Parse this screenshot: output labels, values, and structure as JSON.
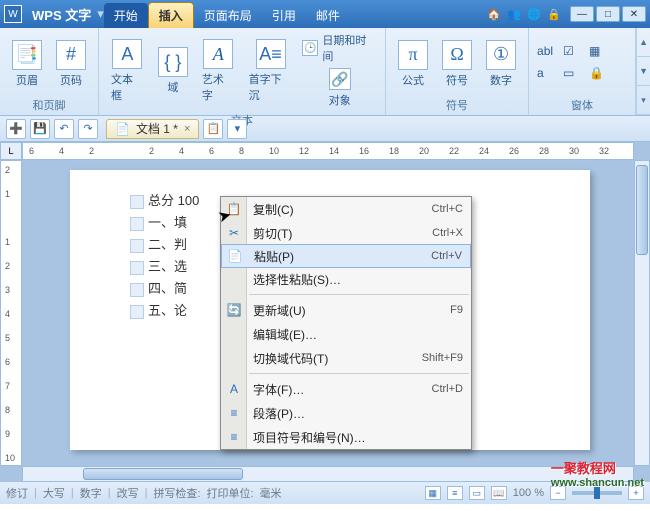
{
  "app": {
    "name": "WPS 文字",
    "icon": "W"
  },
  "tabs": [
    "开始",
    "插入",
    "页面布局",
    "引用",
    "邮件"
  ],
  "active_tab_index": 1,
  "title_icons": [
    "🏠",
    "👥",
    "🌐",
    "🔒"
  ],
  "win": {
    "min": "—",
    "max": "□",
    "close": "✕"
  },
  "ribbon": {
    "groups": [
      {
        "label": "和页脚",
        "big": [
          {
            "icon": "📑",
            "label": "页眉"
          },
          {
            "icon": "#",
            "label": "页码"
          }
        ]
      },
      {
        "label": "文本",
        "big": [
          {
            "icon": "A",
            "label": "文本框"
          },
          {
            "icon": "{ }",
            "label": "域"
          },
          {
            "icon": "A",
            "label": "艺术字",
            "accent": "#2d6fb8"
          },
          {
            "icon": "A≡",
            "label": "首字下沉"
          },
          {
            "icon": "🔗",
            "label": "对象"
          }
        ],
        "stack": [
          {
            "icon": "🕒",
            "label": "日期和时间"
          }
        ]
      },
      {
        "label": "符号",
        "big": [
          {
            "icon": "π",
            "label": "公式"
          },
          {
            "icon": "Ω",
            "label": "符号"
          },
          {
            "icon": "①",
            "label": "数字"
          }
        ]
      },
      {
        "label": "窗体",
        "stack": [
          {
            "icon": "abl",
            "label": ""
          },
          {
            "icon": "☑",
            "label": ""
          },
          {
            "icon": "▦",
            "label": ""
          },
          {
            "icon": "a",
            "label": ""
          },
          {
            "icon": "▭",
            "label": ""
          },
          {
            "icon": "🔒",
            "label": ""
          }
        ]
      }
    ]
  },
  "qat": [
    "➕",
    "💾",
    "↶",
    "↷"
  ],
  "doc_tab": {
    "icon": "📄",
    "title": "文档 1 *"
  },
  "qat_right": [
    "📋",
    "▾"
  ],
  "ruler_h": [
    "6",
    "4",
    "2",
    "",
    "2",
    "4",
    "6",
    "8",
    "10",
    "12",
    "14",
    "16",
    "18",
    "20",
    "22",
    "24",
    "26",
    "28",
    "30",
    "32"
  ],
  "ruler_corner": "L",
  "ruler_v": [
    "2",
    "1",
    "",
    "1",
    "2",
    "3",
    "4",
    "5",
    "6",
    "7",
    "8",
    "9",
    "10"
  ],
  "doc_lines": [
    "总分 100",
    "一、填",
    "二、判",
    "三、选",
    "四、简",
    "五、论"
  ],
  "context_menu": [
    {
      "icon": "📋",
      "label": "复制(C)",
      "key": "Ctrl+C"
    },
    {
      "icon": "✂",
      "label": "剪切(T)",
      "key": "Ctrl+X"
    },
    {
      "icon": "📄",
      "label": "粘贴(P)",
      "key": "Ctrl+V",
      "hl": true
    },
    {
      "icon": "",
      "label": "选择性粘贴(S)…",
      "key": ""
    },
    {
      "sep": true
    },
    {
      "icon": "🔄",
      "label": "更新域(U)",
      "key": "F9"
    },
    {
      "icon": "",
      "label": "编辑域(E)…",
      "key": ""
    },
    {
      "icon": "",
      "label": "切换域代码(T)",
      "key": "Shift+F9"
    },
    {
      "sep": true
    },
    {
      "icon": "A",
      "label": "字体(F)…",
      "key": "Ctrl+D"
    },
    {
      "icon": "≡",
      "label": "段落(P)…",
      "key": ""
    },
    {
      "icon": "≡",
      "label": "项目符号和编号(N)…",
      "key": ""
    }
  ],
  "status": {
    "left": [
      "修订",
      "大写",
      "数字",
      "改写"
    ],
    "spell": "拼写检查:",
    "unit_label": "打印单位:",
    "unit": "毫米",
    "zoom": "100 %"
  },
  "watermark": {
    "main": "一聚教程网",
    "sub": "www.shancun.net"
  }
}
